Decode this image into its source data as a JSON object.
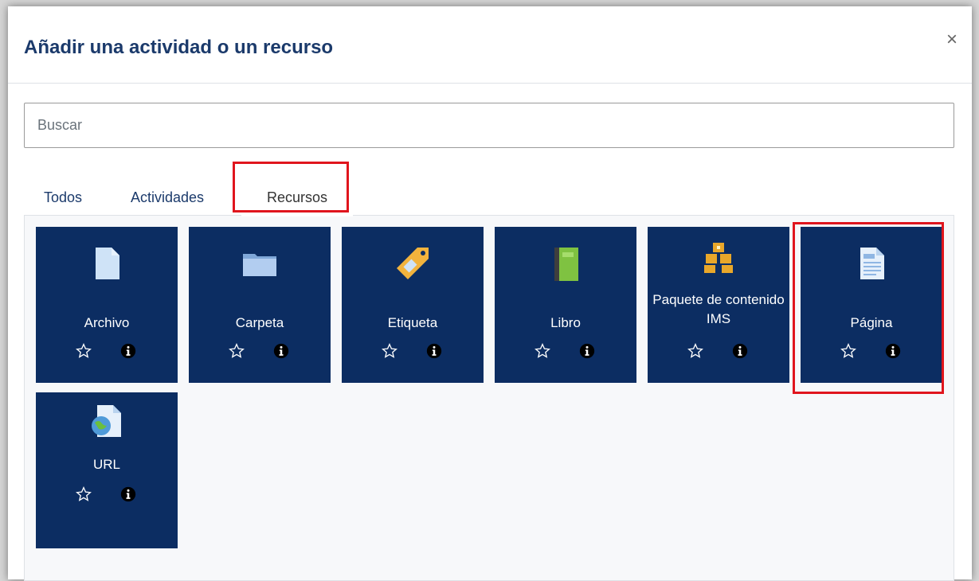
{
  "modal": {
    "title": "Añadir una actividad o un recurso",
    "close_label": "×"
  },
  "search": {
    "placeholder": "Buscar",
    "value": ""
  },
  "tabs": [
    {
      "label": "Todos",
      "active": false
    },
    {
      "label": "Actividades",
      "active": false
    },
    {
      "label": "Recursos",
      "active": true
    }
  ],
  "tiles": [
    {
      "label": "Archivo",
      "icon": "file-icon"
    },
    {
      "label": "Carpeta",
      "icon": "folder-icon"
    },
    {
      "label": "Etiqueta",
      "icon": "tag-icon"
    },
    {
      "label": "Libro",
      "icon": "book-icon"
    },
    {
      "label": "Paquete de contenido IMS",
      "icon": "ims-package-icon"
    },
    {
      "label": "Página",
      "icon": "page-icon"
    },
    {
      "label": "URL",
      "icon": "url-icon"
    }
  ],
  "colors": {
    "title": "#1b3a6b",
    "tile_background": "#0c2d62",
    "highlight": "#e0151d"
  }
}
